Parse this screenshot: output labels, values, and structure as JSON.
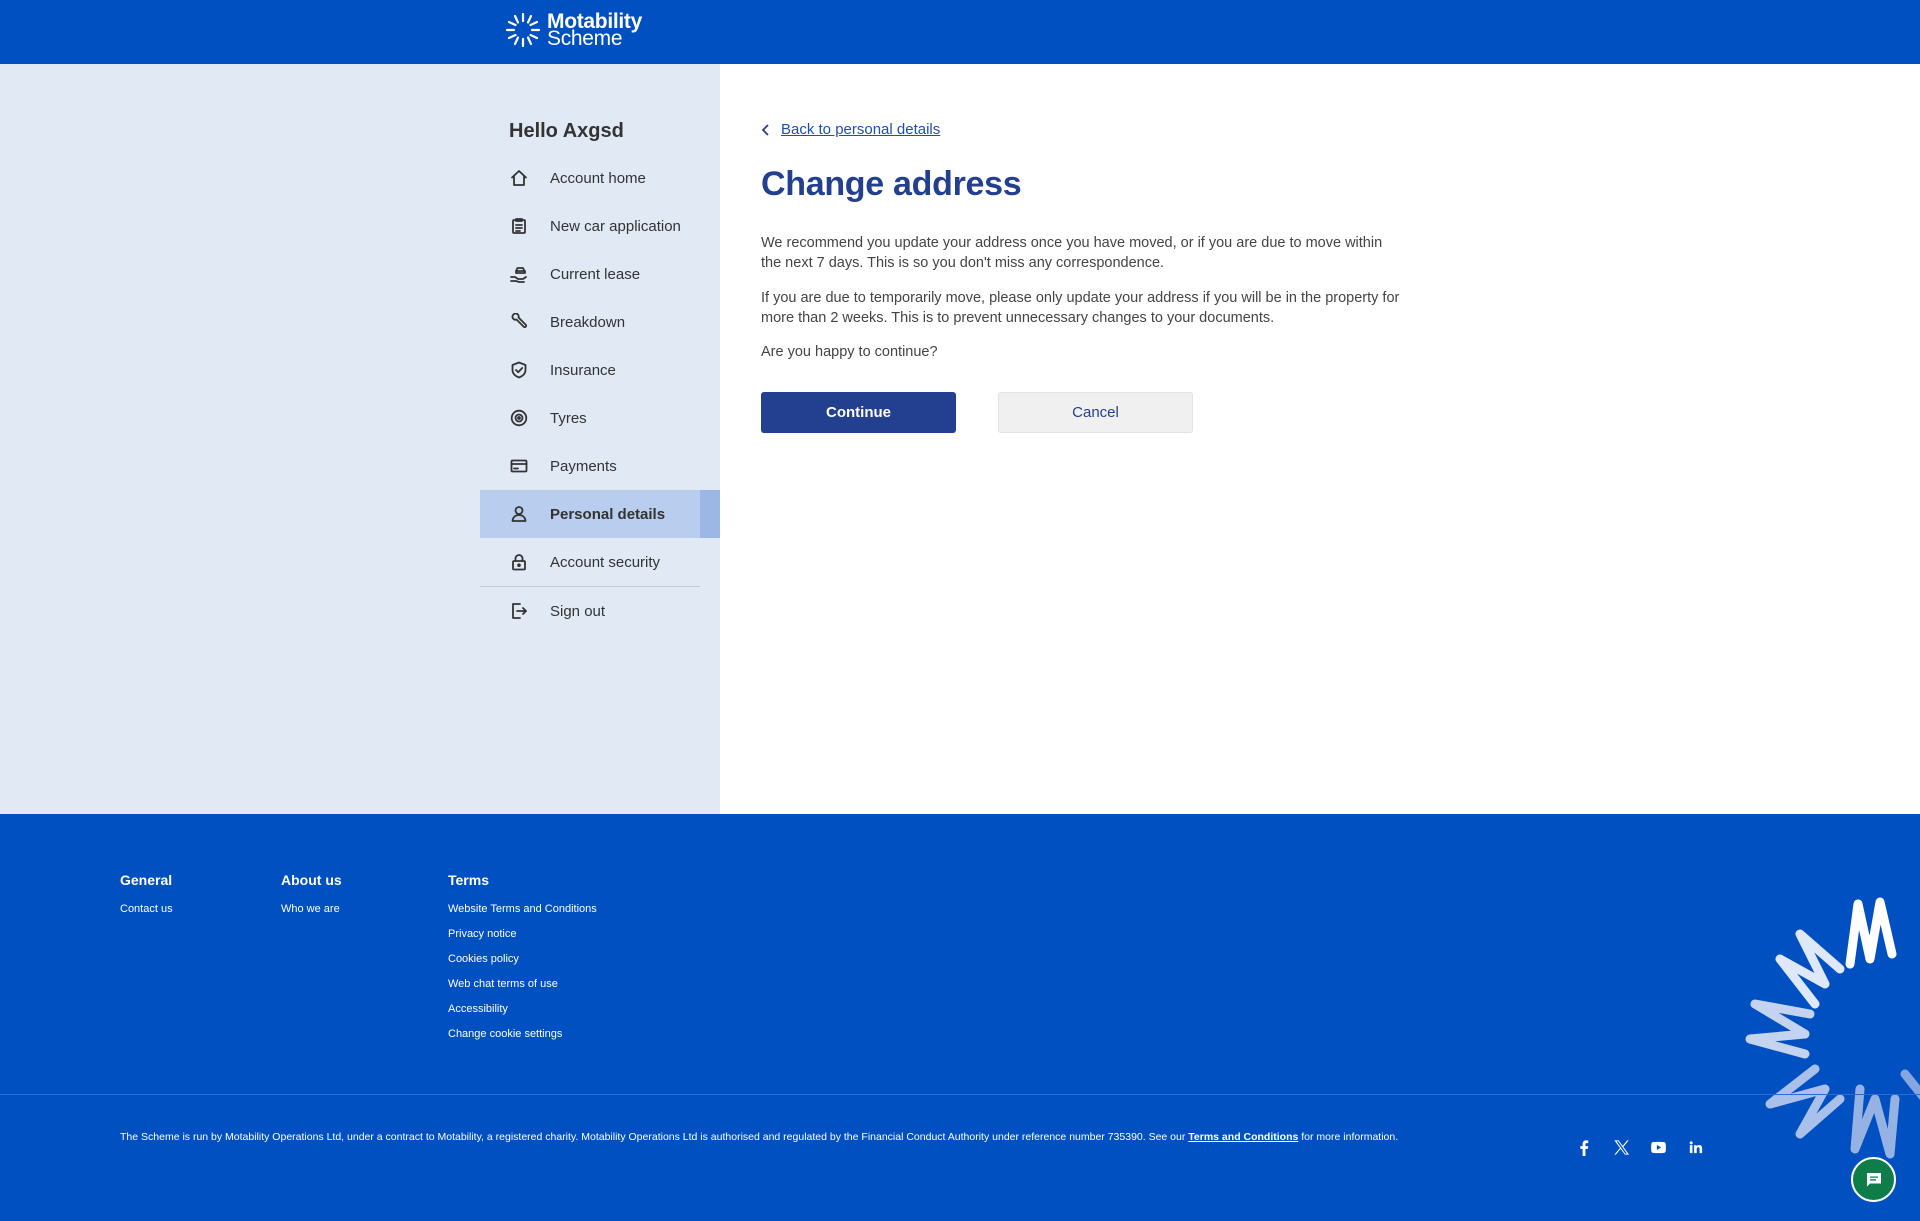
{
  "header": {
    "logo_line1": "Motability",
    "logo_line2": "Scheme"
  },
  "sidebar": {
    "greeting": "Hello Axgsd",
    "items": [
      {
        "label": "Account home",
        "icon": "home-icon"
      },
      {
        "label": "New car application",
        "icon": "clipboard-icon"
      },
      {
        "label": "Current lease",
        "icon": "car-hand-icon"
      },
      {
        "label": "Breakdown",
        "icon": "wrench-icon"
      },
      {
        "label": "Insurance",
        "icon": "shield-check-icon"
      },
      {
        "label": "Tyres",
        "icon": "tyre-icon"
      },
      {
        "label": "Payments",
        "icon": "card-icon"
      },
      {
        "label": "Personal details",
        "icon": "person-icon",
        "active": true
      },
      {
        "label": "Account security",
        "icon": "lock-icon"
      }
    ],
    "signout": {
      "label": "Sign out",
      "icon": "sign-out-icon"
    }
  },
  "main": {
    "back_link": "Back to personal details",
    "title": "Change address",
    "para1": "We recommend you update your address once you have moved, or if you are due to move within the next 7 days. This is so you don't miss any correspondence.",
    "para2": "If you are due to temporarily move, please only update your address if you will be in the property for more than 2 weeks. This is to prevent unnecessary changes to your documents.",
    "para3": "Are you happy to continue?",
    "continue_label": "Continue",
    "cancel_label": "Cancel"
  },
  "footer": {
    "general": {
      "heading": "General",
      "links": [
        "Contact us"
      ]
    },
    "about": {
      "heading": "About us",
      "links": [
        "Who we are"
      ]
    },
    "terms": {
      "heading": "Terms",
      "links": [
        "Website Terms and Conditions",
        "Privacy notice",
        "Cookies policy",
        "Web chat terms of use",
        "Accessibility",
        "Change cookie settings"
      ]
    },
    "legal_text": "The Scheme is run by Motability Operations Ltd, under a contract to Motability, a registered charity. Motability Operations Ltd is authorised and regulated by the Financial Conduct Authority under reference number 735390. See our ",
    "legal_link": "Terms and Conditions",
    "legal_suffix": " for more information.",
    "social": [
      "facebook-icon",
      "x-icon",
      "youtube-icon",
      "linkedin-icon"
    ]
  },
  "colors": {
    "brand_blue": "#0050c2",
    "navy": "#233f8f",
    "sidebar_bg": "#e1e9f5",
    "active_bg": "#b9cdee",
    "chat_green": "#0e7d4a"
  }
}
